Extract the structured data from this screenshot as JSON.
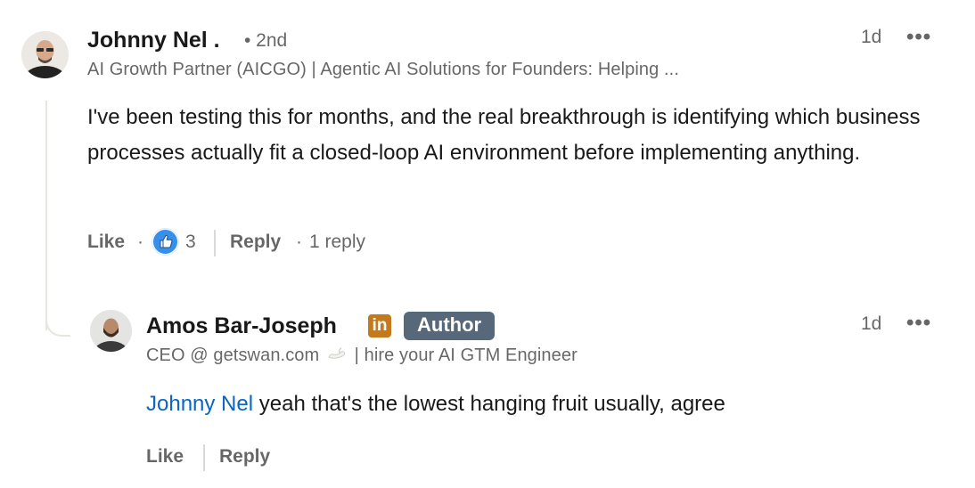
{
  "comment": {
    "author_name": "Johnny Nel .",
    "degree": "• 2nd",
    "headline": "AI Growth Partner (AICGO) | Agentic AI Solutions for Founders: Helping ...",
    "timestamp": "1d",
    "more_label": "•••",
    "body_text": "I've been testing this for months, and the real breakthrough is identifying which business processes actually fit a closed-loop AI environment before implementing anything.",
    "actions": {
      "like_label": "Like",
      "dot1": "·",
      "reaction_count": "3",
      "reply_label": "Reply",
      "dot2": "·",
      "reply_count": "1 reply"
    }
  },
  "reply": {
    "author_name": "Amos Bar-Joseph",
    "linkedin_badge": "in",
    "author_badge": "Author",
    "headline_prefix": "CEO @ getswan.com",
    "headline_suffix": "| hire your AI GTM Engineer",
    "timestamp": "1d",
    "more_label": "•••",
    "mention": "Johnny Nel",
    "body_text": " yeah that's the lowest hanging fruit usually, agree",
    "actions": {
      "like_label": "Like",
      "reply_label": "Reply"
    }
  },
  "colors": {
    "mention": "#0a66c2",
    "reaction_like": "#378fe9",
    "author_badge": "#56687a",
    "linkedin_badge": "#c47a1c"
  },
  "icons": {
    "reaction": "like-thumbs-up-icon",
    "overflow": "more-options-icon",
    "swan": "swan-icon"
  }
}
